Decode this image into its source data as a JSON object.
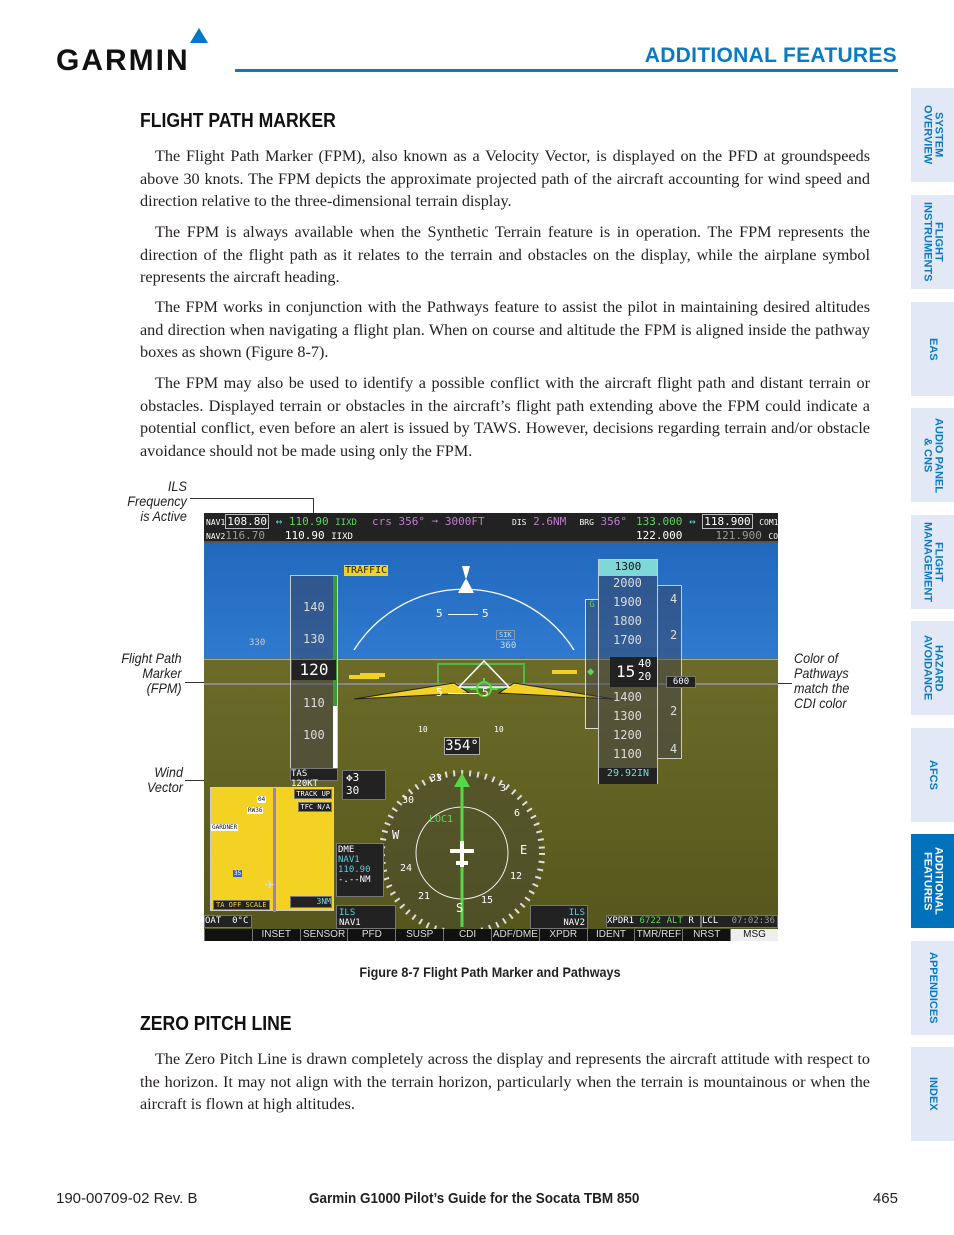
{
  "header": {
    "logo": "GARMIN",
    "section": "ADDITIONAL FEATURES"
  },
  "sections": [
    {
      "title": "FLIGHT PATH MARKER",
      "paragraphs": [
        "The Flight Path Marker (FPM), also known as a Velocity Vector, is displayed on the PFD at groundspeeds above 30 knots.  The FPM depicts the approximate projected path of the aircraft accounting for wind speed and direction relative to the three-dimensional terrain display.",
        "The FPM is always available when the Synthetic Terrain feature is in operation.  The FPM represents the direction of the flight path as it relates to the terrain and obstacles on the display, while the airplane symbol represents the aircraft heading.",
        "The FPM works in conjunction with the Pathways feature to assist the pilot in maintaining desired altitudes and direction when navigating a flight plan.  When on course and altitude the FPM is aligned inside the pathway boxes as shown (Figure 8-7).",
        "The FPM may also be used to identify a possible conflict with the aircraft flight path and distant terrain or obstacles.  Displayed terrain or obstacles in the aircraft’s flight path extending above the FPM could indicate a potential conflict, even before an alert is issued by TAWS.  However, decisions regarding terrain and/or obstacle avoidance should not be made using only the FPM."
      ]
    },
    {
      "title": "ZERO PITCH LINE",
      "paragraphs": [
        "The Zero Pitch Line is drawn completely across the display and represents the aircraft attitude with respect to the horizon.  It may not align with the terrain horizon, particularly when the terrain is mountainous or when the aircraft is flown at high altitudes."
      ]
    }
  ],
  "figure": {
    "caption": "Figure 8-7  Flight Path Marker and Pathways",
    "callouts": {
      "ils": "ILS\nFrequency\nis Active",
      "fpm": "Flight Path\nMarker\n(FPM)",
      "wind": "Wind\nVector",
      "color": "Color of\nPathways\nmatch the\nCDI color"
    },
    "pfd": {
      "nav1_label": "NAV1",
      "nav1_active": "108.80",
      "nav1_standby": "110.90",
      "nav1_id": "IIXD",
      "nav2_label": "NAV2",
      "nav2_active": "116.70",
      "nav2_standby": "110.90",
      "nav2_id": "IIXD",
      "crs": "crs 356°",
      "arrow": "➞",
      "alt_target": "3000FT",
      "dis_label": "DIS",
      "dis": "2.6NM",
      "brg_label": "BRG",
      "brg": "356°",
      "com1_active": "133.000",
      "com1_standby": "118.900",
      "com1_label": "COM1",
      "com2_active": "122.000",
      "com2_standby": "121.900",
      "com2_label": "COM2",
      "traffic": "TRAFFIC",
      "airspeed_ticks": [
        "140",
        "130",
        "110",
        "100"
      ],
      "airspeed": "120",
      "tas": "TAS 120KT",
      "pitch_labels": [
        "5",
        "5",
        "5",
        "5",
        "10",
        "10"
      ],
      "heading_marker": "360",
      "hdg_330": "330",
      "alt_selected": "1300",
      "alt_ticks": [
        "2000",
        "1900",
        "1800",
        "1700",
        "1400",
        "1300",
        "1200",
        "1100"
      ],
      "altitude": "15",
      "alt_roll": "40\n20",
      "baro": "29.92IN",
      "vsi_ticks": [
        "4",
        "2",
        "2",
        "4"
      ],
      "vsi_value": "600",
      "gs_label": "G",
      "heading": "354°",
      "loc": "LOC1",
      "compass": [
        "33",
        "30",
        "W",
        "24",
        "21",
        "S",
        "15",
        "12",
        "E",
        "6",
        "3"
      ],
      "wind": {
        "dir": "✥3",
        "speed": "30"
      },
      "inset": {
        "track_up": "TRACK UP",
        "tfc": "TFC N/A",
        "ta_off": "TA OFF SCALE",
        "range": "3NM",
        "labels": [
          "04",
          "RW36",
          "GARDNER",
          "35"
        ]
      },
      "dme": {
        "label": "DME",
        "source": "NAV1",
        "freq": "110.90",
        "dist": "-.--NM"
      },
      "bearing1": {
        "type": "ILS",
        "source": "NAV1"
      },
      "bearing2": {
        "type": "ILS",
        "source": "NAV2"
      },
      "oat": "OAT",
      "oat_value": "0°C",
      "xpdr": "XPDR1",
      "squawk": "6722",
      "mode": "ALT",
      "r": "R",
      "lcl": "LCL",
      "time": "07:02:36",
      "softkeys": [
        "",
        "INSET",
        "SENSOR",
        "PFD",
        "SUSP",
        "CDI",
        "ADF/DME",
        "XPDR",
        "IDENT",
        "TMR/REF",
        "NRST",
        "MSG"
      ],
      "colors": {
        "sky": "#2f7ad0",
        "ground": "#5c5d20",
        "green": "#5fd35f",
        "magenta": "#c07cd0",
        "cyan": "#5fd0d8",
        "inset_map": "#f4d223"
      }
    }
  },
  "tabs": [
    {
      "label": "SYSTEM\nOVERVIEW"
    },
    {
      "label": "FLIGHT\nINSTRUMENTS"
    },
    {
      "label": "EAS"
    },
    {
      "label": "AUDIO PANEL\n& CNS"
    },
    {
      "label": "FLIGHT\nMANAGEMENT"
    },
    {
      "label": "HAZARD\nAVOIDANCE"
    },
    {
      "label": "AFCS"
    },
    {
      "label": "ADDITIONAL\nFEATURES",
      "active": true
    },
    {
      "label": "APPENDICES"
    },
    {
      "label": "INDEX"
    }
  ],
  "footer": {
    "doc": "190-00709-02  Rev. B",
    "title": "Garmin G1000 Pilot’s Guide for the Socata TBM 850",
    "page": "465"
  },
  "colors": {
    "accent": "#0a7bc2",
    "tab_bg": "#e3e8f6",
    "tab_active": "#0072bc"
  }
}
